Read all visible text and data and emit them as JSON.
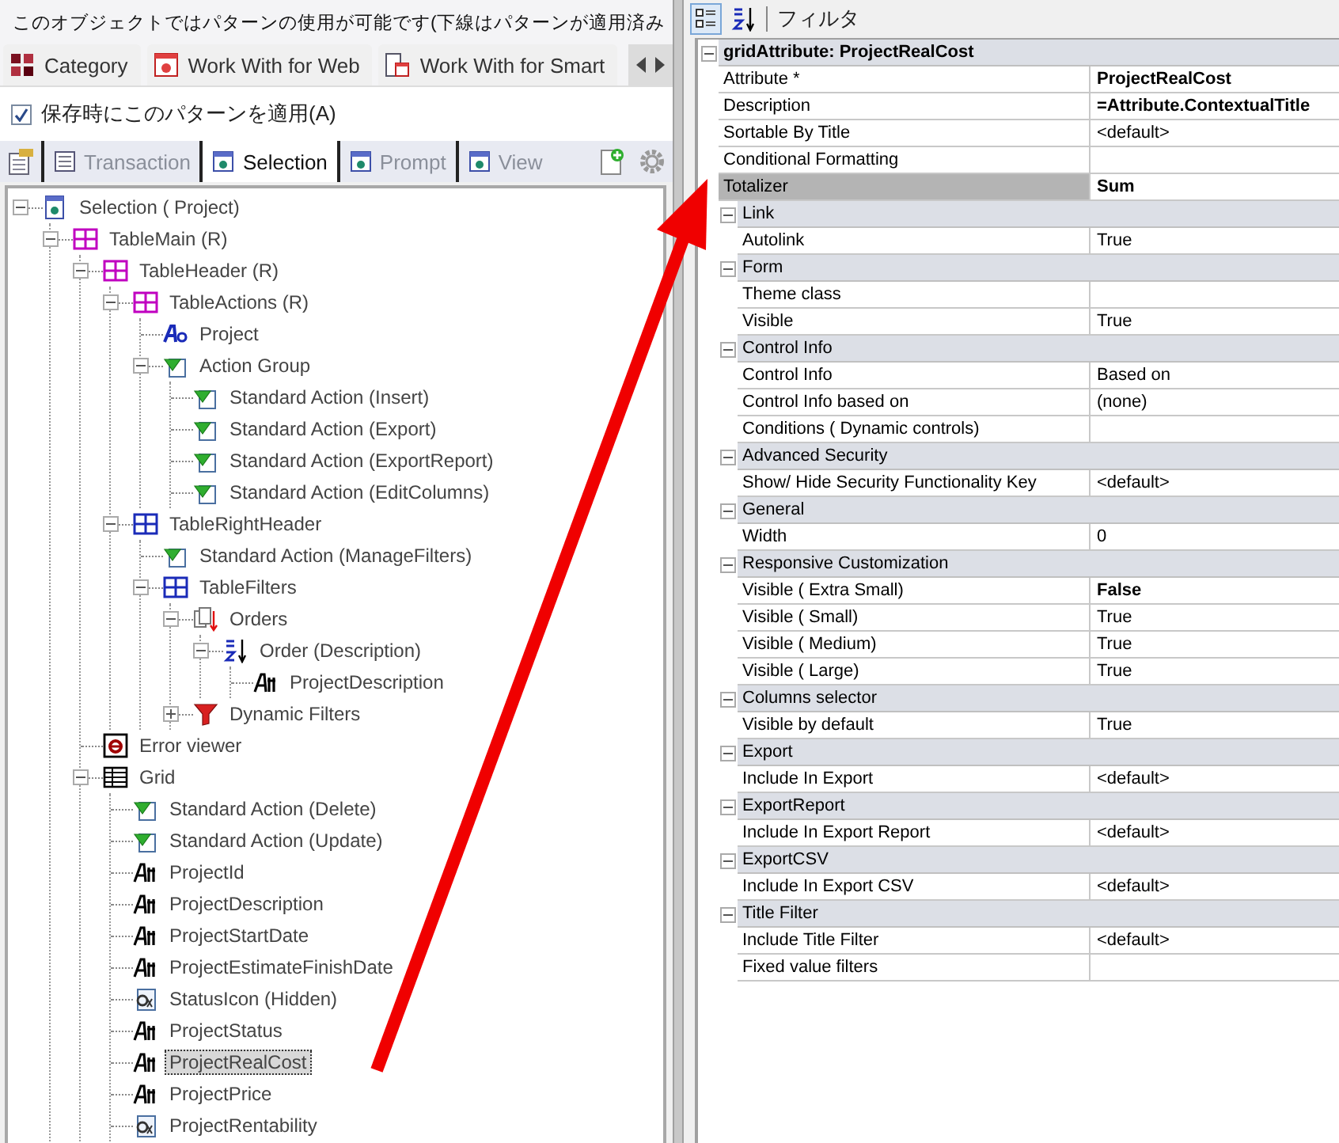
{
  "message": "このオブジェクトではパターンの使用が可能です(下線はパターンが適用済み",
  "pattern_tabs": [
    {
      "label": "Category",
      "kind": "category"
    },
    {
      "label": "Work With for Web",
      "kind": "web"
    },
    {
      "label": "Work With for Smart",
      "kind": "smart"
    }
  ],
  "apply_on_save": {
    "label": "保存時にこのパターンを適用(A)",
    "checked": true
  },
  "instance_tabs": [
    {
      "label": "Transaction",
      "kind": "transaction",
      "selected": false
    },
    {
      "label": "Selection",
      "kind": "instance",
      "selected": true
    },
    {
      "label": "Prompt",
      "kind": "instance",
      "selected": false
    },
    {
      "label": "View",
      "kind": "instance",
      "selected": false
    }
  ],
  "tree": [
    {
      "label": "Selection ( Project)",
      "kind": "instance",
      "expanded": true,
      "selected": false,
      "children": [
        {
          "label": "TableMain (R)",
          "kind": "table-r",
          "expanded": true,
          "selected": false,
          "children": [
            {
              "label": "TableHeader (R)",
              "kind": "table-r",
              "expanded": true,
              "selected": false,
              "children": [
                {
                  "label": "TableActions (R)",
                  "kind": "table-r",
                  "expanded": true,
                  "selected": false,
                  "children": [
                    {
                      "label": "Project",
                      "kind": "text",
                      "selected": false
                    },
                    {
                      "label": "Action Group",
                      "kind": "action",
                      "expanded": true,
                      "selected": false,
                      "children": [
                        {
                          "label": "Standard Action (Insert)",
                          "kind": "action",
                          "selected": false
                        },
                        {
                          "label": "Standard Action (Export)",
                          "kind": "action",
                          "selected": false
                        },
                        {
                          "label": "Standard Action (ExportReport)",
                          "kind": "action",
                          "selected": false
                        },
                        {
                          "label": "Standard Action (EditColumns)",
                          "kind": "action",
                          "selected": false
                        }
                      ]
                    }
                  ]
                },
                {
                  "label": "TableRightHeader",
                  "kind": "table",
                  "expanded": true,
                  "selected": false,
                  "children": [
                    {
                      "label": "Standard Action (ManageFilters)",
                      "kind": "action",
                      "selected": false
                    },
                    {
                      "label": "TableFilters",
                      "kind": "table",
                      "expanded": true,
                      "selected": false,
                      "children": [
                        {
                          "label": "Orders",
                          "kind": "orders",
                          "expanded": true,
                          "selected": false,
                          "children": [
                            {
                              "label": "Order (Description)",
                              "kind": "order",
                              "expanded": true,
                              "selected": false,
                              "children": [
                                {
                                  "label": "ProjectDescription",
                                  "kind": "attribute",
                                  "selected": false
                                }
                              ]
                            }
                          ]
                        },
                        {
                          "label": "Dynamic Filters",
                          "kind": "filter",
                          "expanded": false,
                          "selected": false
                        }
                      ]
                    }
                  ]
                }
              ]
            },
            {
              "label": "Error viewer",
              "kind": "error",
              "selected": false
            },
            {
              "label": "Grid",
              "kind": "grid",
              "expanded": true,
              "selected": false,
              "children": [
                {
                  "label": "Standard Action (Delete)",
                  "kind": "action",
                  "selected": false
                },
                {
                  "label": "Standard Action (Update)",
                  "kind": "action",
                  "selected": false
                },
                {
                  "label": "ProjectId",
                  "kind": "attribute",
                  "selected": false
                },
                {
                  "label": "ProjectDescription",
                  "kind": "attribute",
                  "selected": false
                },
                {
                  "label": "ProjectStartDate",
                  "kind": "attribute",
                  "selected": false
                },
                {
                  "label": "ProjectEstimateFinishDate",
                  "kind": "attribute",
                  "selected": false
                },
                {
                  "label": "StatusIcon (Hidden)",
                  "kind": "variable",
                  "selected": false
                },
                {
                  "label": "ProjectStatus",
                  "kind": "attribute",
                  "selected": false
                },
                {
                  "label": "ProjectRealCost",
                  "kind": "attribute",
                  "selected": true
                },
                {
                  "label": "ProjectPrice",
                  "kind": "attribute",
                  "selected": false
                },
                {
                  "label": "ProjectRentability",
                  "kind": "variable",
                  "selected": false
                }
              ]
            }
          ]
        }
      ]
    }
  ],
  "property_grid": {
    "toolbar": {
      "categorized_selected": true,
      "alphabetical_selected": false,
      "filter_label": "フィルタ"
    },
    "object": {
      "title": "gridAttribute: ProjectRealCost",
      "expanded": true,
      "properties": [
        {
          "name": "Attribute *",
          "value": "ProjectRealCost",
          "modified": true,
          "selected": false
        },
        {
          "name": "Description",
          "value": "=Attribute.ContextualTitle",
          "modified": true,
          "selected": false
        },
        {
          "name": "Sortable By Title",
          "value": "<default>",
          "modified": false,
          "selected": false
        },
        {
          "name": "Conditional Formatting",
          "modified": false,
          "selected": false
        },
        {
          "name": "Totalizer",
          "value": "Sum",
          "modified": true,
          "selected": true
        }
      ],
      "categories": [
        {
          "name": "Link",
          "expanded": true,
          "properties": [
            {
              "name": "Autolink",
              "value": "True",
              "modified": false,
              "selected": false
            }
          ]
        },
        {
          "name": "Form",
          "expanded": true,
          "properties": [
            {
              "name": "Theme class",
              "modified": false,
              "selected": false
            },
            {
              "name": "Visible",
              "value": "True",
              "modified": false,
              "selected": false
            }
          ]
        },
        {
          "name": "Control Info",
          "expanded": true,
          "properties": [
            {
              "name": "Control Info",
              "value": "Based on",
              "modified": false,
              "selected": false
            },
            {
              "name": "Control Info based on",
              "value": "(none)",
              "modified": false,
              "selected": false
            },
            {
              "name": "Conditions ( Dynamic controls)",
              "modified": false,
              "selected": false
            }
          ]
        },
        {
          "name": "Advanced Security",
          "expanded": true,
          "properties": [
            {
              "name": "Show/ Hide Security Functionality Key",
              "value": "<default>",
              "modified": false,
              "selected": false
            }
          ]
        },
        {
          "name": "General",
          "expanded": true,
          "properties": [
            {
              "name": "Width",
              "value": "0",
              "modified": false,
              "selected": false
            }
          ]
        },
        {
          "name": "Responsive Customization",
          "expanded": true,
          "properties": [
            {
              "name": "Visible ( Extra Small)",
              "value": "False",
              "modified": true,
              "selected": false
            },
            {
              "name": "Visible ( Small)",
              "value": "True",
              "modified": false,
              "selected": false
            },
            {
              "name": "Visible ( Medium)",
              "value": "True",
              "modified": false,
              "selected": false
            },
            {
              "name": "Visible ( Large)",
              "value": "True",
              "modified": false,
              "selected": false
            }
          ]
        },
        {
          "name": "Columns selector",
          "expanded": true,
          "properties": [
            {
              "name": "Visible by default",
              "value": "True",
              "modified": false,
              "selected": false
            }
          ]
        },
        {
          "name": "Export",
          "expanded": true,
          "properties": [
            {
              "name": "Include In Export",
              "value": "<default>",
              "modified": false,
              "selected": false
            }
          ]
        },
        {
          "name": "ExportReport",
          "expanded": true,
          "properties": [
            {
              "name": "Include In Export Report",
              "value": "<default>",
              "modified": false,
              "selected": false
            }
          ]
        },
        {
          "name": "ExportCSV",
          "expanded": true,
          "properties": [
            {
              "name": "Include In Export CSV",
              "value": "<default>",
              "modified": false,
              "selected": false
            }
          ]
        },
        {
          "name": "Title Filter",
          "expanded": true,
          "properties": [
            {
              "name": "Include Title Filter",
              "value": "<default>",
              "modified": false,
              "selected": false
            },
            {
              "name": "Fixed value filters",
              "modified": false,
              "selected": false
            }
          ]
        }
      ]
    }
  }
}
